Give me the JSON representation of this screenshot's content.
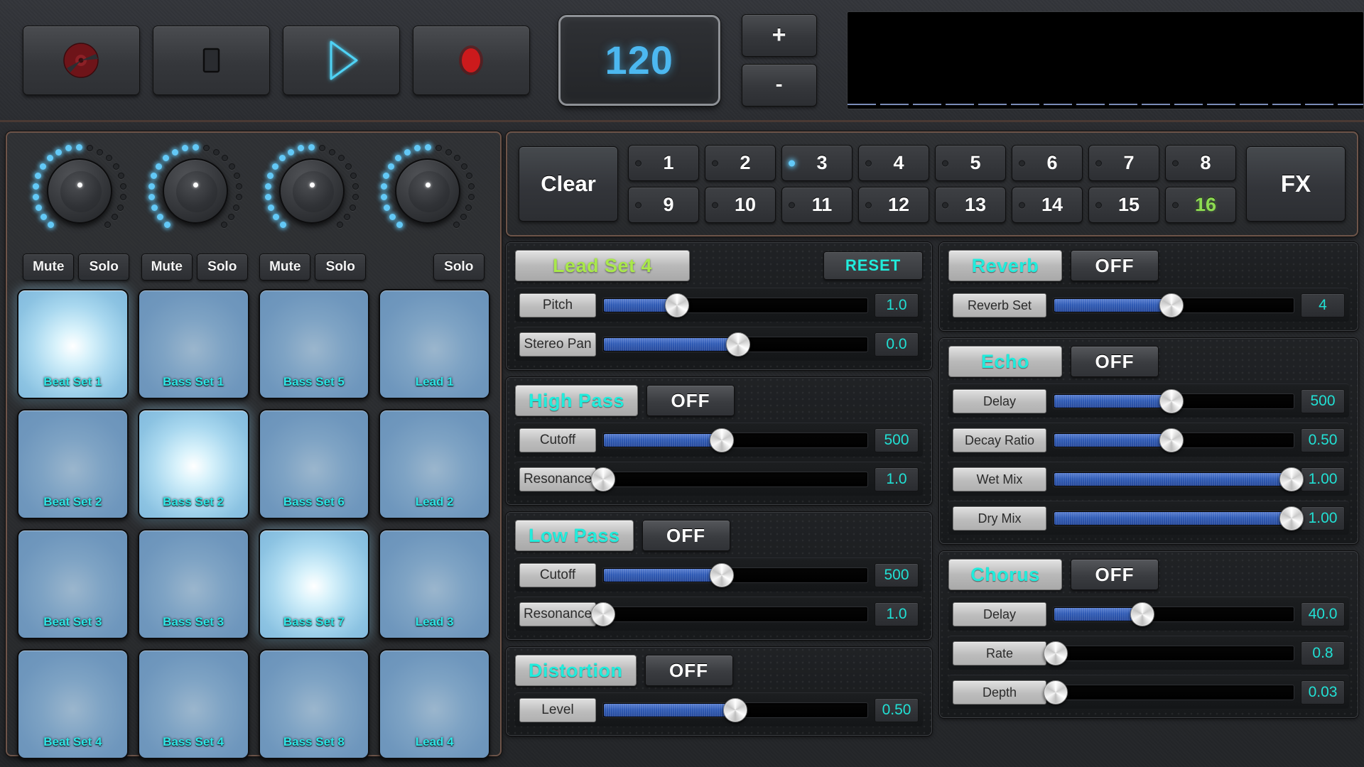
{
  "transport": {
    "buttons": [
      {
        "name": "rewind-button",
        "icon": "disc-icon"
      },
      {
        "name": "stop-button",
        "icon": "stop-square-icon"
      },
      {
        "name": "play-button",
        "icon": "play-triangle-icon"
      },
      {
        "name": "record-button",
        "icon": "record-dot-icon"
      }
    ],
    "bpm": "120",
    "bpm_increase_label": "+",
    "bpm_decrease_label": "-",
    "waveform_segments": 16
  },
  "mixer": {
    "channels": [
      {
        "knob_label": "channel-1-volume",
        "mute": "Mute",
        "solo": "Solo",
        "has_mute": true
      },
      {
        "knob_label": "channel-2-volume",
        "mute": "Mute",
        "solo": "Solo",
        "has_mute": true
      },
      {
        "knob_label": "channel-3-volume",
        "mute": "Mute",
        "solo": "Solo",
        "has_mute": true
      },
      {
        "knob_label": "channel-4-volume",
        "mute": "Mute",
        "solo": "Solo",
        "has_mute": false
      }
    ],
    "pads": [
      {
        "label": "Beat Set 1",
        "active": true
      },
      {
        "label": "Bass Set 1",
        "active": false
      },
      {
        "label": "Bass Set 5",
        "active": false
      },
      {
        "label": "Lead 1",
        "active": false
      },
      {
        "label": "Beat Set 2",
        "active": false
      },
      {
        "label": "Bass Set 2",
        "active": true
      },
      {
        "label": "Bass Set 6",
        "active": false
      },
      {
        "label": "Lead 2",
        "active": false
      },
      {
        "label": "Beat Set 3",
        "active": false
      },
      {
        "label": "Bass Set 3",
        "active": false
      },
      {
        "label": "Bass Set 7",
        "active": true
      },
      {
        "label": "Lead 3",
        "active": false
      },
      {
        "label": "Beat Set 4",
        "active": false
      },
      {
        "label": "Bass Set 4",
        "active": false
      },
      {
        "label": "Bass Set 8",
        "active": false
      },
      {
        "label": "Lead 4",
        "active": false
      }
    ]
  },
  "sequencer": {
    "clear_label": "Clear",
    "fx_label": "FX",
    "steps": [
      {
        "num": "1",
        "led": false,
        "green": false
      },
      {
        "num": "2",
        "led": false,
        "green": false
      },
      {
        "num": "3",
        "led": true,
        "green": false
      },
      {
        "num": "4",
        "led": false,
        "green": false
      },
      {
        "num": "5",
        "led": false,
        "green": false
      },
      {
        "num": "6",
        "led": false,
        "green": false
      },
      {
        "num": "7",
        "led": false,
        "green": false
      },
      {
        "num": "8",
        "led": false,
        "green": false
      },
      {
        "num": "9",
        "led": false,
        "green": false
      },
      {
        "num": "10",
        "led": false,
        "green": false
      },
      {
        "num": "11",
        "led": false,
        "green": false
      },
      {
        "num": "12",
        "led": false,
        "green": false
      },
      {
        "num": "13",
        "led": false,
        "green": false
      },
      {
        "num": "14",
        "led": false,
        "green": false
      },
      {
        "num": "15",
        "led": false,
        "green": false
      },
      {
        "num": "16",
        "led": false,
        "green": true
      }
    ]
  },
  "track_editor": {
    "cards": [
      {
        "title": "Lead Set 4",
        "title_color": "green",
        "toggle": null,
        "reset_label": "RESET",
        "rows": [
          {
            "label": "Pitch",
            "value": "1.0",
            "fill_pct": 28,
            "wide": false
          },
          {
            "label": "Stereo Pan",
            "value": "0.0",
            "fill_pct": 51,
            "wide": false
          }
        ]
      },
      {
        "title": "High Pass",
        "title_color": "cyan",
        "toggle": "OFF",
        "reset_label": null,
        "rows": [
          {
            "label": "Cutoff",
            "value": "500",
            "fill_pct": 45,
            "wide": false
          },
          {
            "label": "Resonance",
            "value": "1.0",
            "fill_pct": 0,
            "wide": false
          }
        ]
      },
      {
        "title": "Low Pass",
        "title_color": "cyan",
        "toggle": "OFF",
        "reset_label": null,
        "rows": [
          {
            "label": "Cutoff",
            "value": "500",
            "fill_pct": 45,
            "wide": false
          },
          {
            "label": "Resonance",
            "value": "1.0",
            "fill_pct": 0,
            "wide": false
          }
        ]
      },
      {
        "title": "Distortion",
        "title_color": "cyan",
        "toggle": "OFF",
        "reset_label": null,
        "rows": [
          {
            "label": "Level",
            "value": "0.50",
            "fill_pct": 50,
            "wide": false
          }
        ]
      }
    ]
  },
  "fx_rack": {
    "cards": [
      {
        "title": "Reverb",
        "title_color": "cyan",
        "toggle": "OFF",
        "reset_label": null,
        "rows": [
          {
            "label": "Reverb Set",
            "value": "4",
            "fill_pct": 49,
            "wide": true
          }
        ]
      },
      {
        "title": "Echo",
        "title_color": "cyan",
        "toggle": "OFF",
        "reset_label": null,
        "rows": [
          {
            "label": "Delay",
            "value": "500",
            "fill_pct": 49,
            "wide": true
          },
          {
            "label": "Decay Ratio",
            "value": "0.50",
            "fill_pct": 49,
            "wide": true
          },
          {
            "label": "Wet Mix",
            "value": "1.00",
            "fill_pct": 99,
            "wide": true
          },
          {
            "label": "Dry Mix",
            "value": "1.00",
            "fill_pct": 99,
            "wide": true
          }
        ]
      },
      {
        "title": "Chorus",
        "title_color": "cyan",
        "toggle": "OFF",
        "reset_label": null,
        "rows": [
          {
            "label": "Delay",
            "value": "40.0",
            "fill_pct": 37,
            "wide": true
          },
          {
            "label": "Rate",
            "value": "0.8",
            "fill_pct": 1,
            "wide": true
          },
          {
            "label": "Depth",
            "value": "0.03",
            "fill_pct": 1,
            "wide": true
          }
        ]
      }
    ]
  },
  "colors": {
    "accent_cyan": "#21ecdc",
    "accent_green": "#a9e84b",
    "led_blue": "#63c9f7",
    "slider_blue": "#2f5bb5",
    "pad_label": "#2ee6e6",
    "bpm_blue": "#4cb8f0"
  }
}
